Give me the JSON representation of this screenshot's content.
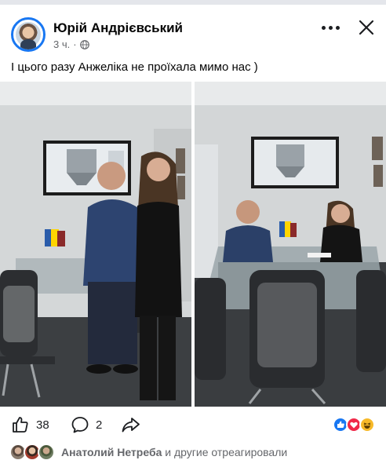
{
  "post": {
    "author": "Юрій Андрієвський",
    "time": "3 ч.",
    "separator": "·",
    "caption": "І цього разу Анжеліка не проїхала мимо нас )"
  },
  "photos": [
    {
      "description": "two-people-standing-in-meeting-room"
    },
    {
      "description": "two-people-seated-at-glass-meeting-table"
    }
  ],
  "actions": {
    "like_count": "38",
    "comment_count": "2"
  },
  "reactions": {
    "name": "Анатолий Нетреба",
    "rest": "и другие отреагировали"
  },
  "icons": [
    "globe-icon",
    "more-icon",
    "close-icon",
    "like-icon",
    "comment-icon",
    "share-icon",
    "like-reaction-icon",
    "love-reaction-icon",
    "haha-reaction-icon"
  ],
  "colors": {
    "accent": "#1877f2",
    "love": "#f02849",
    "haha": "#f7b928",
    "secondary_text": "#65676b"
  }
}
